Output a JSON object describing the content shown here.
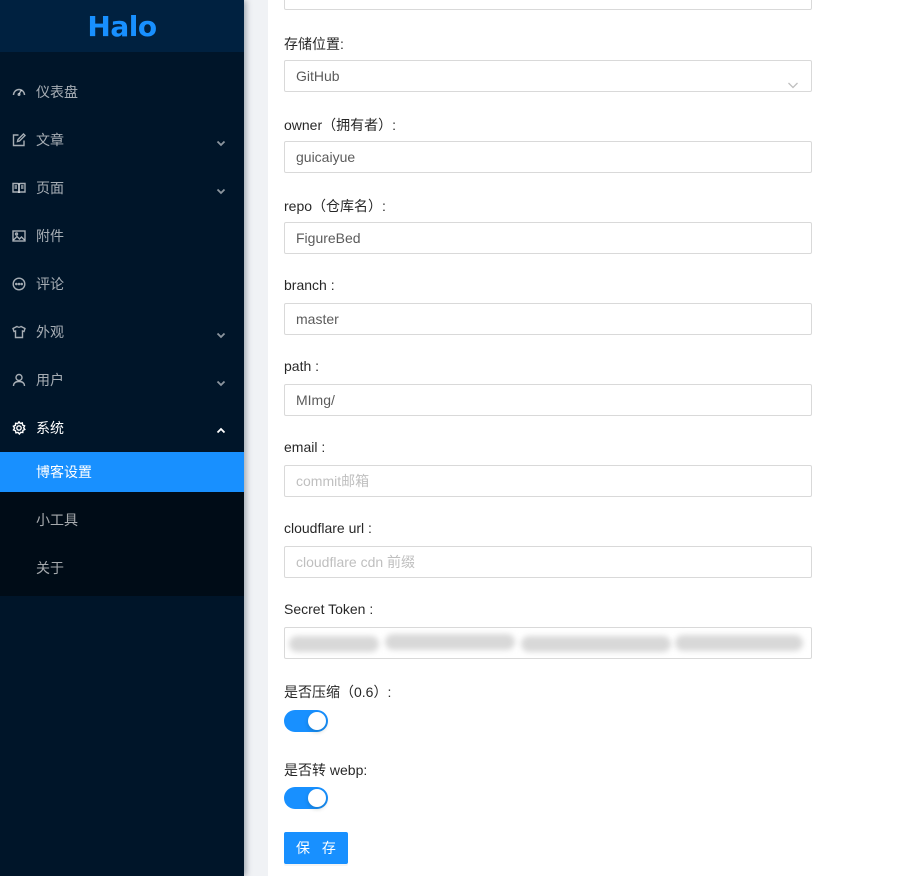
{
  "sidebar": {
    "logo": "Halo",
    "items": [
      {
        "label": "仪表盘",
        "icon": "dashboard-icon"
      },
      {
        "label": "文章",
        "icon": "edit-icon"
      },
      {
        "label": "页面",
        "icon": "book-icon"
      },
      {
        "label": "附件",
        "icon": "picture-icon"
      },
      {
        "label": "评论",
        "icon": "message-icon"
      },
      {
        "label": "外观",
        "icon": "skin-icon"
      },
      {
        "label": "用户",
        "icon": "user-icon"
      },
      {
        "label": "系统",
        "icon": "setting-icon"
      }
    ],
    "system_submenu": [
      {
        "label": "博客设置",
        "active": true
      },
      {
        "label": "小工具",
        "active": false
      },
      {
        "label": "关于",
        "active": false
      }
    ]
  },
  "form": {
    "storage_label": "存储位置:",
    "storage_value": "GitHub",
    "owner_label": "owner（拥有者）:",
    "owner_value": "guicaiyue",
    "repo_label": "repo（仓库名）:",
    "repo_value": "FigureBed",
    "branch_label": "branch :",
    "branch_value": "master",
    "path_label": "path :",
    "path_value": "MImg/",
    "email_label": "email :",
    "email_placeholder": "commit邮箱",
    "cloudflare_label": "cloudflare url :",
    "cloudflare_placeholder": "cloudflare cdn 前缀",
    "token_label": "Secret Token :",
    "compress_label": "是否压缩（0.6）:",
    "compress_on": true,
    "webp_label": "是否转 webp:",
    "webp_on": true,
    "save_label": "保 存"
  },
  "colors": {
    "sidebar_bg": "#001529",
    "primary": "#1890ff"
  }
}
